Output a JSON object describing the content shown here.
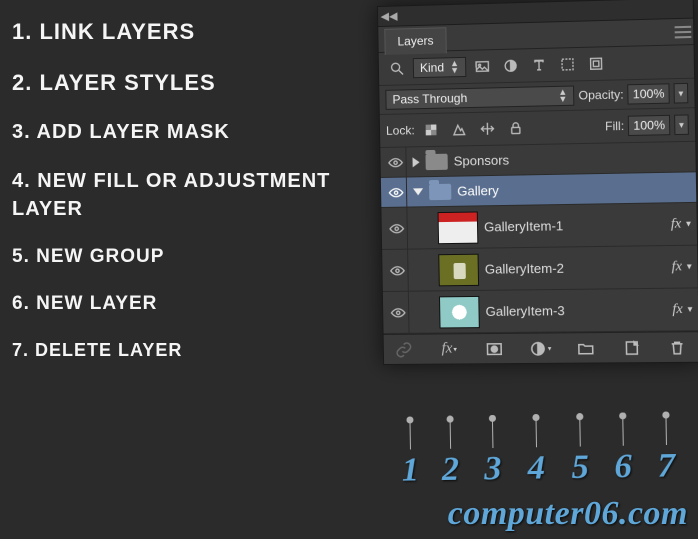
{
  "legend": {
    "items": [
      {
        "num": "1.",
        "text": "LINK LAYERS"
      },
      {
        "num": "2.",
        "text": "LAYER STYLES"
      },
      {
        "num": "3.",
        "text": "ADD LAYER MASK"
      },
      {
        "num": "4.",
        "text": "NEW FILL OR ADJUSTMENT LAYER"
      },
      {
        "num": "5.",
        "text": "NEW GROUP"
      },
      {
        "num": "6.",
        "text": "NEW LAYER"
      },
      {
        "num": "7.",
        "text": "DELETE LAYER"
      }
    ]
  },
  "panel": {
    "tab_label": "Layers",
    "filter": {
      "mode": "Kind"
    },
    "blend": {
      "mode": "Pass Through",
      "opacity_label": "Opacity:",
      "opacity_value": "100%"
    },
    "lock": {
      "label": "Lock:",
      "fill_label": "Fill:",
      "fill_value": "100%"
    },
    "layers": [
      {
        "type": "group",
        "name": "Sponsors",
        "expanded": false,
        "selected": false
      },
      {
        "type": "group",
        "name": "Gallery",
        "expanded": true,
        "selected": true
      },
      {
        "type": "layer",
        "name": "GalleryItem-1",
        "thumb": "red",
        "fx": true
      },
      {
        "type": "layer",
        "name": "GalleryItem-2",
        "thumb": "olive",
        "fx": true
      },
      {
        "type": "layer",
        "name": "GalleryItem-3",
        "thumb": "teal",
        "fx": true
      }
    ],
    "fx_badge": "fx",
    "bottom_buttons": [
      {
        "name": "link-layers-button",
        "icon": "link"
      },
      {
        "name": "layer-styles-button",
        "icon": "fx"
      },
      {
        "name": "layer-mask-button",
        "icon": "mask"
      },
      {
        "name": "adjustment-layer-button",
        "icon": "adjust"
      },
      {
        "name": "new-group-button",
        "icon": "folder"
      },
      {
        "name": "new-layer-button",
        "icon": "newpage"
      },
      {
        "name": "delete-layer-button",
        "icon": "trash"
      }
    ]
  },
  "callouts": [
    "1",
    "2",
    "3",
    "4",
    "5",
    "6",
    "7"
  ],
  "watermark": "computer06.com"
}
